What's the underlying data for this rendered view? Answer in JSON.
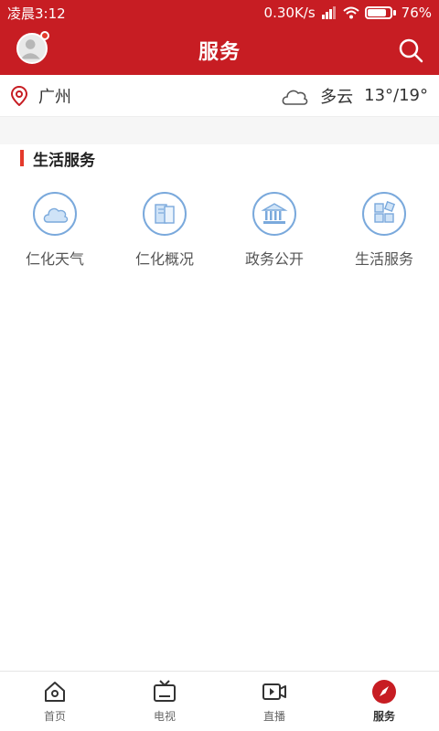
{
  "status_bar": {
    "time": "凌晨3:12",
    "network_speed": "0.30K/s",
    "battery": "76%"
  },
  "header": {
    "title": "服务"
  },
  "location": {
    "city": "广州",
    "weather": "多云",
    "temperature": "13°/19°"
  },
  "section": {
    "title": "生活服务"
  },
  "services": [
    {
      "label": "仁化天气",
      "icon": "cloud-icon"
    },
    {
      "label": "仁化概况",
      "icon": "book-icon"
    },
    {
      "label": "政务公开",
      "icon": "government-building-icon"
    },
    {
      "label": "生活服务",
      "icon": "grid-blocks-icon"
    }
  ],
  "tabs": [
    {
      "label": "首页",
      "icon": "home-icon"
    },
    {
      "label": "电视",
      "icon": "tv-icon"
    },
    {
      "label": "直播",
      "icon": "video-icon"
    },
    {
      "label": "服务",
      "icon": "compass-icon",
      "active": true
    }
  ],
  "colors": {
    "brand": "#c71d23",
    "accent": "#e43a2c",
    "icon_blue": "#7aa9dc"
  }
}
